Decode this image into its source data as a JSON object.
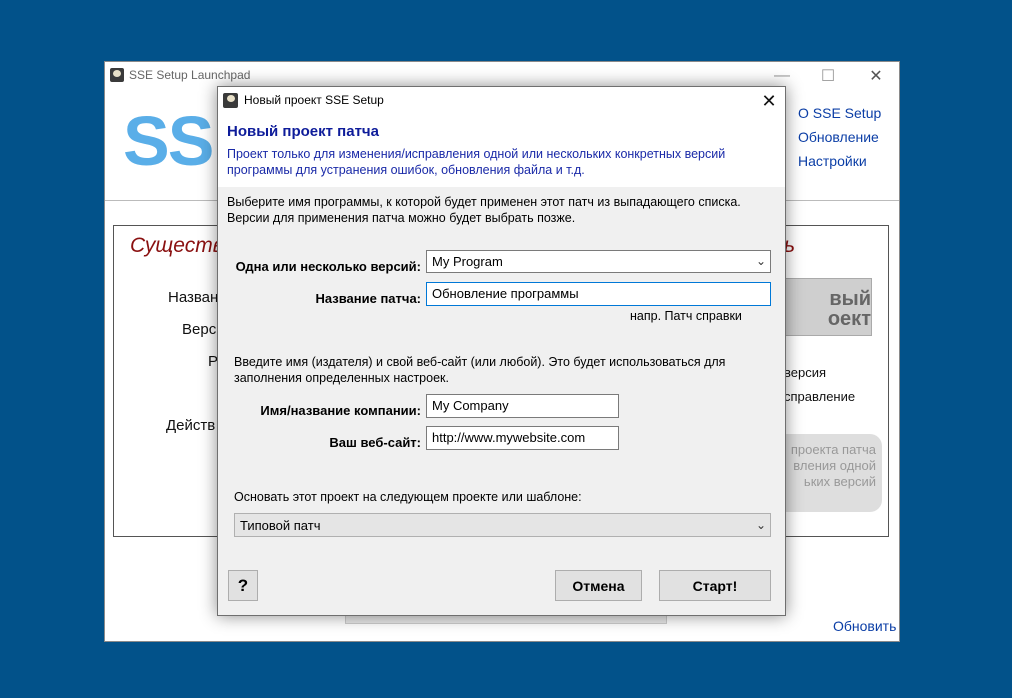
{
  "main_window": {
    "title": "SSE Setup Launchpad",
    "logo": "SSE",
    "nav": [
      "О SSE Setup",
      "Обновление",
      "Настройки"
    ],
    "panel_title_left": "Существ",
    "panel_title_right": "ь",
    "labels": [
      "Назван",
      "Верс",
      "Р",
      "Действ"
    ],
    "new_project_button": "вый\nоект",
    "radio_labels": [
      "версия",
      "справление"
    ],
    "bubble_text": "проекта патча\nвления одной\nьких версий",
    "update_link": "Обновить"
  },
  "dialog": {
    "title": "Новый проект SSE Setup",
    "heading": "Новый проект патча",
    "description": "Проект только для изменения/исправления одной или нескольких конкретных версий программы для устранения ошибок, обновления файла и т.д.",
    "intro": "Выберите имя программы, к которой будет применен этот патч из выпадающего списка. Версии для применения патча можно будет выбрать позже.",
    "versions": {
      "label": "Одна или несколько версий:",
      "value": "My Program"
    },
    "patch_name": {
      "label": "Название патча:",
      "value": "Обновление программы",
      "hint": "напр. Патч справки"
    },
    "publisher_description": "Введите имя (издателя) и свой веб-сайт (или любой). Это будет использоваться для заполнения определенных настроек.",
    "company": {
      "label": "Имя/название компании:",
      "value": "My Company"
    },
    "website": {
      "label": "Ваш веб-сайт:",
      "value": "http://www.mywebsite.com"
    },
    "template": {
      "label": "Основать этот проект на следующем проекте или шаблоне:",
      "value": "Типовой патч"
    },
    "buttons": {
      "help": "?",
      "cancel": "Отмена",
      "start": "Старт!"
    }
  },
  "colors": {
    "desktop": "#02528a",
    "heading": "#0e1c9a",
    "link": "#0b3ea6",
    "panel_title": "#8a1010",
    "logo": "#5aaee8"
  }
}
